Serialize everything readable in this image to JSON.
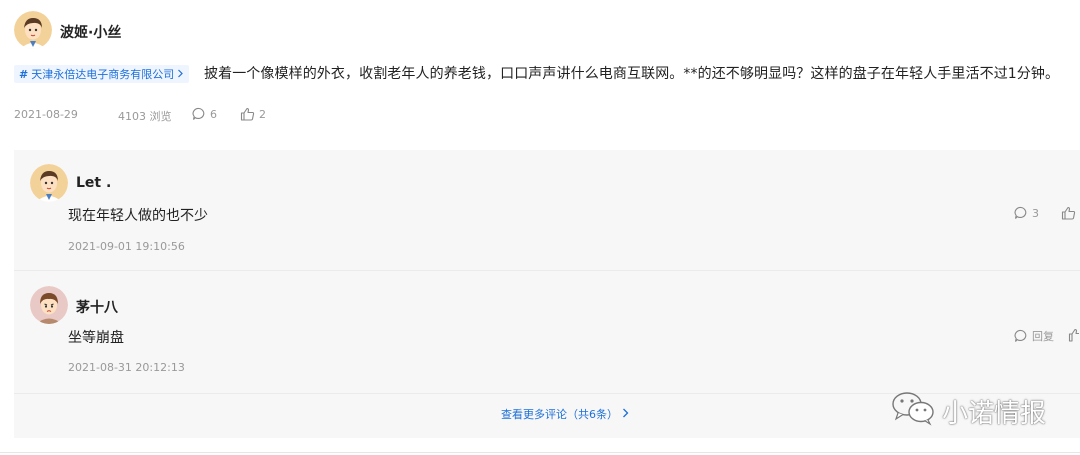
{
  "post": {
    "author": "波姬·小丝",
    "tag_label": "天津永倍达电子商务有限公司",
    "text": "披着一个像模样的外衣，收割老年人的养老钱，口口声声讲什么电商互联网。**的还不够明显吗？这样的盘子在年轻人手里活不过1分钟。",
    "date": "2021-08-29",
    "views": "4103 浏览",
    "comment_count": "6",
    "like_count": "2"
  },
  "comments": [
    {
      "author": "Let .",
      "text": "现在年轻人做的也不少",
      "date": "2021-09-01 19:10:56",
      "reply_count": "3"
    },
    {
      "author": "茅十八",
      "text": "坐等崩盘",
      "date": "2021-08-31 20:12:13",
      "reply_label": "回复"
    }
  ],
  "more_comments": "查看更多评论（共6条）",
  "watermark": "小诺情报",
  "icons": {
    "tag": "hash-icon",
    "chevron": "chevron-right-icon",
    "comment": "comment-bubble-icon",
    "like": "thumbs-up-icon",
    "watermark": "wechat-icon"
  },
  "colors": {
    "link": "#1e6fd9",
    "meta": "#999999",
    "panel": "#f7f7f7"
  }
}
